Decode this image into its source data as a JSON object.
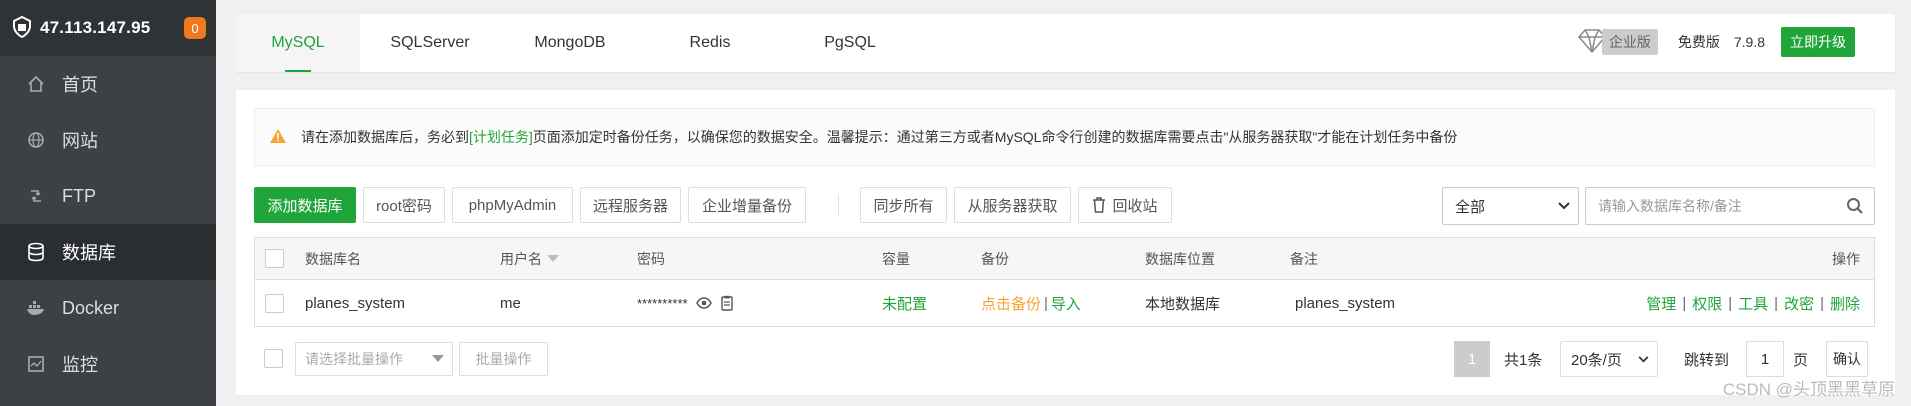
{
  "sidebar": {
    "server_ip": "47.113.147.95",
    "badge_count": "0",
    "items": [
      {
        "label": "首页",
        "icon": "home-icon"
      },
      {
        "label": "网站",
        "icon": "globe-icon"
      },
      {
        "label": "FTP",
        "icon": "ftp-icon"
      },
      {
        "label": "数据库",
        "icon": "database-icon"
      },
      {
        "label": "Docker",
        "icon": "docker-icon"
      },
      {
        "label": "监控",
        "icon": "monitor-icon"
      }
    ],
    "active_item": "数据库"
  },
  "tabs": [
    "MySQL",
    "SQLServer",
    "MongoDB",
    "Redis",
    "PgSQL"
  ],
  "active_tab": "MySQL",
  "version": {
    "enterprise_label": "企业版",
    "edition": "免费版",
    "number": "7.9.8",
    "upgrade_label": "立即升级"
  },
  "notice": {
    "prefix": "请在添加数据库后，务必到",
    "link": "[计划任务]",
    "suffix": "页面添加定时备份任务，以确保您的数据安全。温馨提示：通过第三方或者MySQL命令行创建的数据库需要点击\"从服务器获取\"才能在计划任务中备份"
  },
  "toolbar": {
    "add_db": "添加数据库",
    "root_pwd": "root密码",
    "phpmyadmin": "phpMyAdmin",
    "remote_server": "远程服务器",
    "incremental_backup": "企业增量备份",
    "sync_all": "同步所有",
    "get_from_server": "从服务器获取",
    "recycle_bin": "回收站",
    "filter_value": "全部",
    "search_placeholder": "请输入数据库名称/备注"
  },
  "table": {
    "headers": {
      "name": "数据库名",
      "user": "用户名",
      "password": "密码",
      "capacity": "容量",
      "backup": "备份",
      "location": "数据库位置",
      "note": "备注",
      "ops": "操作"
    },
    "rows": [
      {
        "name": "planes_system",
        "user": "me",
        "password": "**********",
        "capacity": "未配置",
        "backup_click": "点击备份",
        "backup_sep": "|",
        "backup_import": "导入",
        "location": "本地数据库",
        "note": "planes_system",
        "ops": [
          "管理",
          "权限",
          "工具",
          "改密",
          "删除"
        ]
      }
    ]
  },
  "footer": {
    "batch_placeholder": "请选择批量操作",
    "batch_button": "批量操作",
    "current_page": "1",
    "total": "共1条",
    "per_page": "20条/页",
    "jump_label": "跳转到",
    "jump_value": "1",
    "page_unit": "页",
    "confirm": "确认"
  },
  "watermark": "CSDN @头顶黑黑草原",
  "colors": {
    "accent": "#20a53a",
    "orange": "#f7a234",
    "sidebar": "#3d4145"
  }
}
